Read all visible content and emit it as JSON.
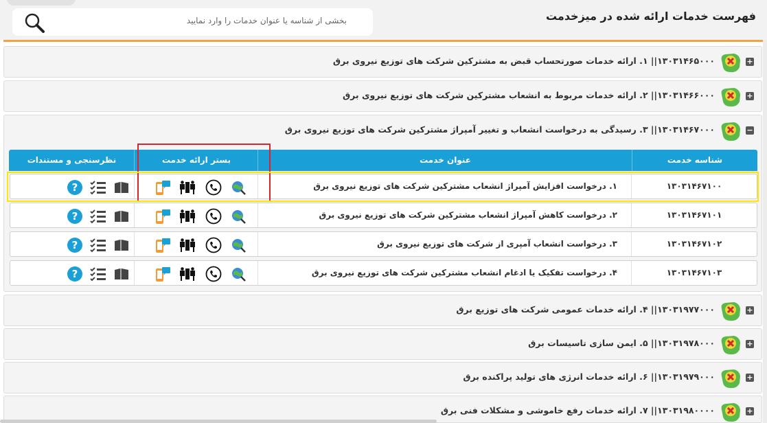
{
  "header": {
    "title": "فهرست خدمات ارائه شده در میزخدمت",
    "search_placeholder": "بخشی از شناسه یا عنوان خدمات را وارد نمایید"
  },
  "categories": [
    {
      "label": "۱۳۰۳۱۴۶۵۰۰۰|| ۱. ارائه خدمات صورتحساب قبض به مشترکین شرکت های توزیع نیروی برق",
      "state": "+"
    },
    {
      "label": "۱۳۰۳۱۴۶۶۰۰۰|| ۲. ارائه خدمات مربوط به انشعاب مشترکین شرکت های توزیع نیروی برق",
      "state": "+"
    },
    {
      "label": "۱۳۰۳۱۴۶۷۰۰۰|| ۳. رسیدگی به درخواست انشعاب و تغییر آمپراژ مشترکین شرکت های توزیع نیروی برق",
      "state": "−"
    },
    {
      "label": "۱۳۰۳۱۹۷۷۰۰۰|| ۴. ارائه خدمات عمومی شرکت های توزیع برق",
      "state": "+"
    },
    {
      "label": "۱۳۰۳۱۹۷۸۰۰۰|| ۵. ایمن سازی تاسیسات برق",
      "state": "+"
    },
    {
      "label": "۱۳۰۳۱۹۷۹۰۰۰|| ۶. ارائه خدمات انرژی های تولید پراکنده برق",
      "state": "+"
    },
    {
      "label": "۱۳۰۳۱۹۸۰۰۰۰|| ۷. ارائه خدمات رفع خاموشی و مشکلات فنی برق",
      "state": "+"
    }
  ],
  "table": {
    "headers": [
      "شناسه خدمت",
      "عنوان خدمت",
      "بستر ارائه خدمت",
      "نظرسنجی و مستندات"
    ],
    "rows": [
      {
        "id": "۱۳۰۳۱۴۶۷۱۰۰",
        "title": "۱. درخواست افزایش آمپراژ انشعاب مشترکین شرکت های توزیع نیروی برق"
      },
      {
        "id": "۱۳۰۳۱۴۶۷۱۰۱",
        "title": "۲. درخواست کاهش آمپراژ انشعاب مشترکین شرکت های توزیع نیروی برق"
      },
      {
        "id": "۱۳۰۳۱۴۶۷۱۰۲",
        "title": "۳. درخواست انشعاب آمپری از شرکت های توزیع نیروی برق"
      },
      {
        "id": "۱۳۰۳۱۴۶۷۱۰۳",
        "title": "۴. درخواست تفکیک یا ادغام انشعاب مشترکین شرکت های توزیع نیروی برق"
      }
    ]
  },
  "icons": {
    "platform": [
      "web-service-icon",
      "phone-icon",
      "in-person-icon",
      "mobile-app-icon"
    ],
    "evaluation": [
      "documents-icon",
      "checklist-icon",
      "help-icon"
    ]
  },
  "colors": {
    "table_header": "#1aa0d6",
    "accent_rule": "#f0a24a",
    "highlight_red": "#d9232d",
    "highlight_yellow": "#ffe600",
    "help": "#1aa0d6"
  }
}
